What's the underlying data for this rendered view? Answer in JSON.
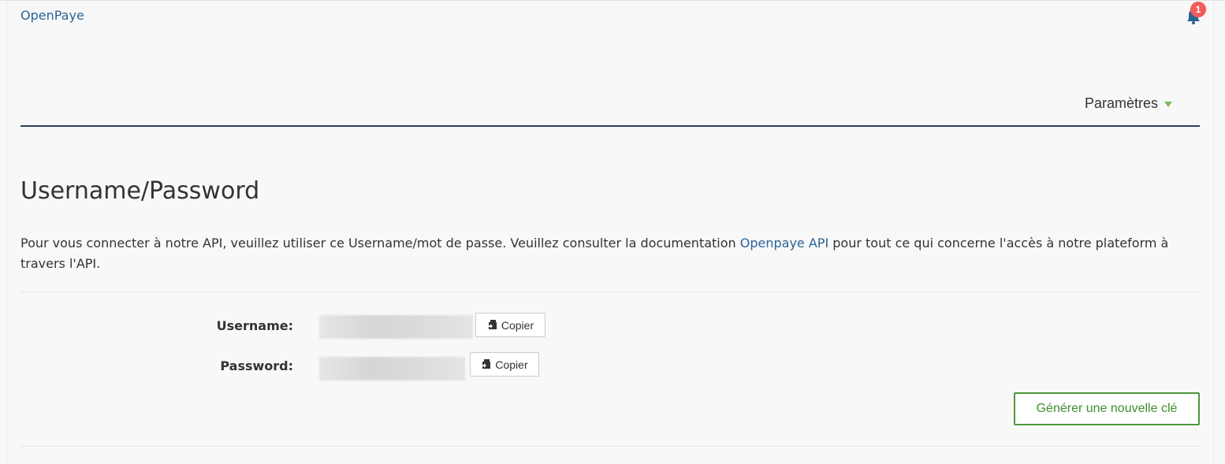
{
  "header": {
    "brand": "OpenPaye",
    "notification_count": "1"
  },
  "nav": {
    "settings_label": "Paramètres"
  },
  "main": {
    "title": "Username/Password",
    "intro_before": "Pour vous connecter à notre API, veuillez utiliser ce Username/mot de passe. Veuillez consulter la documentation ",
    "intro_link": "Openpaye API",
    "intro_after": " pour tout ce qui concerne l'accès à notre plateform à travers l'API."
  },
  "credentials": {
    "username_label": "Username:",
    "password_label": "Password:",
    "copy_label": "Copier",
    "generate_label": "Générer une nouvelle clé"
  },
  "colors": {
    "link": "#2a6496",
    "badge": "#f15b5b",
    "accent_green": "#4c9a3a",
    "divider": "#2c3e5c"
  }
}
